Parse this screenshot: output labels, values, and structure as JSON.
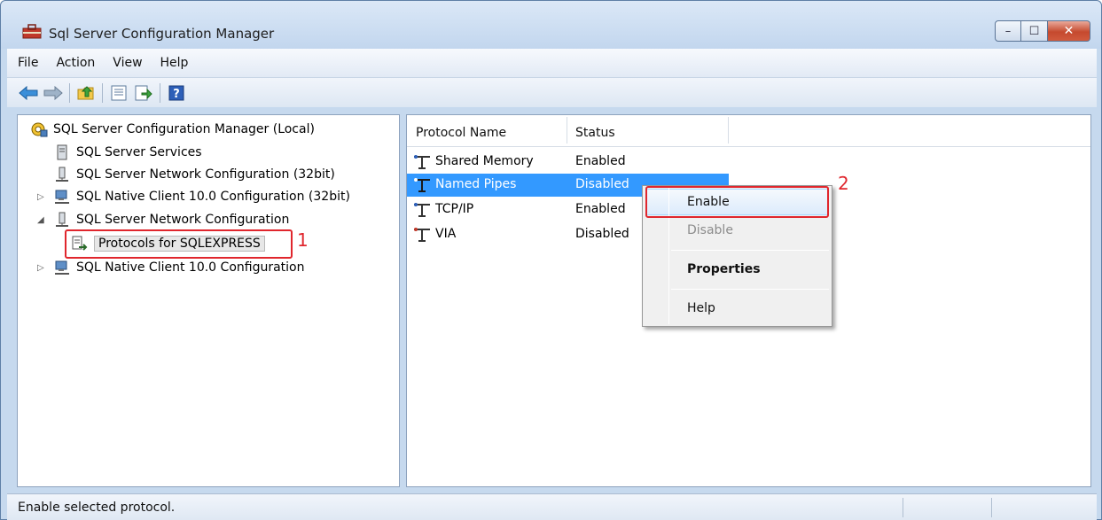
{
  "window": {
    "title": "Sql Server Configuration Manager",
    "controls": {
      "minimize": "–",
      "maximize": "☐",
      "close": "✕"
    }
  },
  "menu": [
    "File",
    "Action",
    "View",
    "Help"
  ],
  "toolbar": {
    "icons": [
      "back-arrow-icon",
      "forward-arrow-icon",
      "up-folder-icon",
      "properties-icon",
      "export-icon",
      "help-icon"
    ],
    "help_glyph": "?"
  },
  "tree": {
    "root": "SQL Server Configuration Manager (Local)",
    "items": [
      {
        "label": "SQL Server Services",
        "icon": "server-icon"
      },
      {
        "label": "SQL Server Network Configuration (32bit)",
        "icon": "network-config-icon"
      },
      {
        "label": "SQL Native Client 10.0 Configuration (32bit)",
        "icon": "native-client-icon",
        "expander": "▷"
      },
      {
        "label": "SQL Server Network Configuration",
        "icon": "network-config-icon",
        "expander": "◢"
      },
      {
        "label": "Protocols for SQLEXPRESS",
        "icon": "protocols-icon",
        "selected": true
      },
      {
        "label": "SQL Native Client 10.0 Configuration",
        "icon": "native-client-icon",
        "expander": "▷"
      }
    ]
  },
  "list": {
    "columns": [
      "Protocol Name",
      "Status"
    ],
    "rows": [
      {
        "name": "Shared Memory",
        "status": "Enabled"
      },
      {
        "name": "Named Pipes",
        "status": "Disabled",
        "selected": true
      },
      {
        "name": "TCP/IP",
        "status": "Enabled"
      },
      {
        "name": "VIA",
        "status": "Disabled"
      }
    ]
  },
  "context_menu": {
    "items": [
      {
        "label": "Enable",
        "enabled": true,
        "highlighted": true
      },
      {
        "label": "Disable",
        "enabled": false
      },
      {
        "label": "Properties",
        "enabled": true,
        "bold": true
      },
      {
        "label": "Help",
        "enabled": true
      }
    ]
  },
  "annotations": {
    "callout_1": "1",
    "callout_2": "2",
    "color": "#e0262d"
  },
  "statusbar": {
    "text": "Enable selected protocol."
  }
}
